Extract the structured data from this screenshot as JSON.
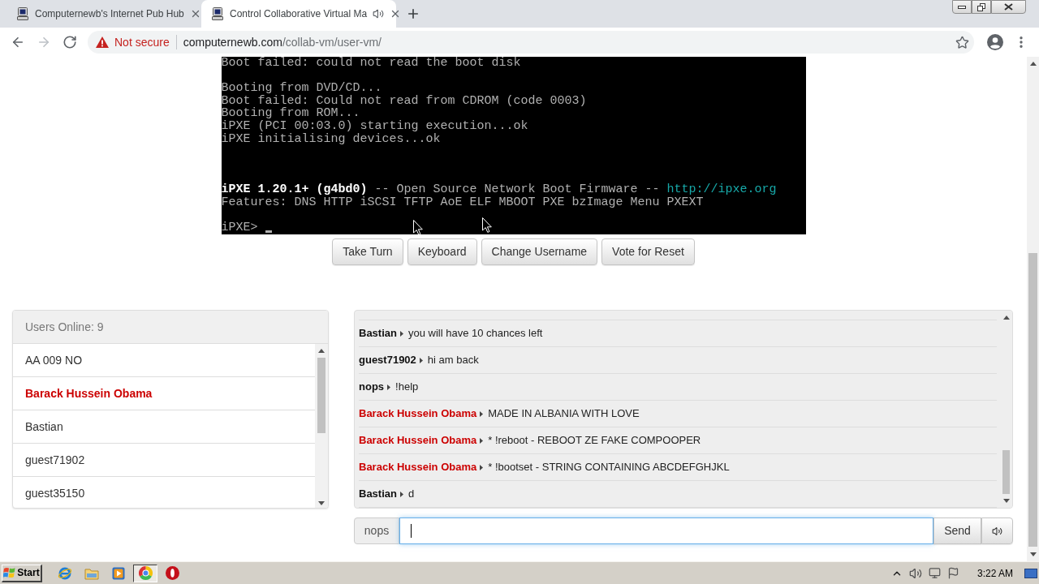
{
  "browser": {
    "tabs": [
      {
        "title": "Computernewb's Internet Pub Hub",
        "selected": false,
        "audio": false
      },
      {
        "title": "Control Collaborative Virtual Ma",
        "selected": true,
        "audio": true
      }
    ],
    "nav_buttons": [
      {
        "kind": "back",
        "disabled": false
      },
      {
        "kind": "forward",
        "disabled": true
      },
      {
        "kind": "reload",
        "disabled": false
      }
    ],
    "address": {
      "security": "Not secure",
      "host": "computernewb.com",
      "path": "/collab-vm/user-vm/"
    }
  },
  "vm_screen": {
    "lines": [
      {
        "kind": "text",
        "segments": [
          {
            "text": "Boot failed: could not read the boot disk",
            "kind": "normal"
          }
        ]
      },
      {
        "kind": "blank"
      },
      {
        "kind": "text",
        "segments": [
          {
            "text": "Booting from DVD/CD...",
            "kind": "normal"
          }
        ]
      },
      {
        "kind": "text",
        "segments": [
          {
            "text": "Boot failed: Could not read from CDROM (code 0003)",
            "kind": "normal"
          }
        ]
      },
      {
        "kind": "text",
        "segments": [
          {
            "text": "Booting from ROM...",
            "kind": "normal"
          }
        ]
      },
      {
        "kind": "text",
        "segments": [
          {
            "text": "iPXE (PCI 00:03.0) starting execution...ok",
            "kind": "normal"
          }
        ]
      },
      {
        "kind": "text",
        "segments": [
          {
            "text": "iPXE initialising devices...ok",
            "kind": "normal"
          }
        ]
      },
      {
        "kind": "blank"
      },
      {
        "kind": "blank"
      },
      {
        "kind": "blank"
      },
      {
        "kind": "text",
        "segments": [
          {
            "text": "iPXE 1.20.1+ (g4bd0)",
            "kind": "bright"
          },
          {
            "text": " -- Open Source Network Boot Firmware -- ",
            "kind": "normal"
          },
          {
            "text": "http://ipxe.org",
            "kind": "link"
          }
        ]
      },
      {
        "kind": "text",
        "segments": [
          {
            "text": "Features: DNS HTTP iSCSI TFTP AoE ELF MBOOT PXE bzImage Menu PXEXT",
            "kind": "normal"
          }
        ]
      },
      {
        "kind": "blank"
      },
      {
        "kind": "prompt",
        "segments": [
          {
            "text": "iPXE> ",
            "kind": "normal"
          }
        ]
      }
    ],
    "cursor": true
  },
  "vm_controls": [
    "Take Turn",
    "Keyboard",
    "Change Username",
    "Vote for Reset"
  ],
  "users_panel": {
    "heading": "Users Online: 9",
    "users": [
      {
        "name": "AA 009 NO",
        "kind": "user"
      },
      {
        "name": "Barack Hussein Obama",
        "kind": "admin"
      },
      {
        "name": "Bastian",
        "kind": "user"
      },
      {
        "name": "guest71902",
        "kind": "user"
      },
      {
        "name": "guest35150",
        "kind": "user"
      }
    ]
  },
  "chat": {
    "messages": [
      {
        "user": "Bastian",
        "kind": "user",
        "text": "you will have 10 chances left"
      },
      {
        "user": "guest71902",
        "kind": "user",
        "text": "hi am back"
      },
      {
        "user": "nops",
        "kind": "user",
        "text": "!help"
      },
      {
        "user": "Barack Hussein Obama",
        "kind": "admin",
        "text": "MADE IN ALBANIA WITH LOVE"
      },
      {
        "user": "Barack Hussein Obama",
        "kind": "admin",
        "text": "* !reboot - REBOOT ZE FAKE COMPOOPER"
      },
      {
        "user": "Barack Hussein Obama",
        "kind": "admin",
        "text": "* !bootset - STRING CONTAINING ABCDEFGHJKL"
      },
      {
        "user": "Bastian",
        "kind": "user",
        "text": "d"
      }
    ],
    "input": {
      "prefix": "nops",
      "focused": true
    },
    "send_label": "Send"
  },
  "taskbar": {
    "start": "Start",
    "apps": [
      {
        "kind": "ie",
        "selected": false
      },
      {
        "kind": "folder",
        "selected": false
      },
      {
        "kind": "media",
        "selected": false
      },
      {
        "kind": "chrome",
        "selected": true
      },
      {
        "kind": "ring",
        "selected": false
      }
    ],
    "clock": "3:22 AM"
  }
}
